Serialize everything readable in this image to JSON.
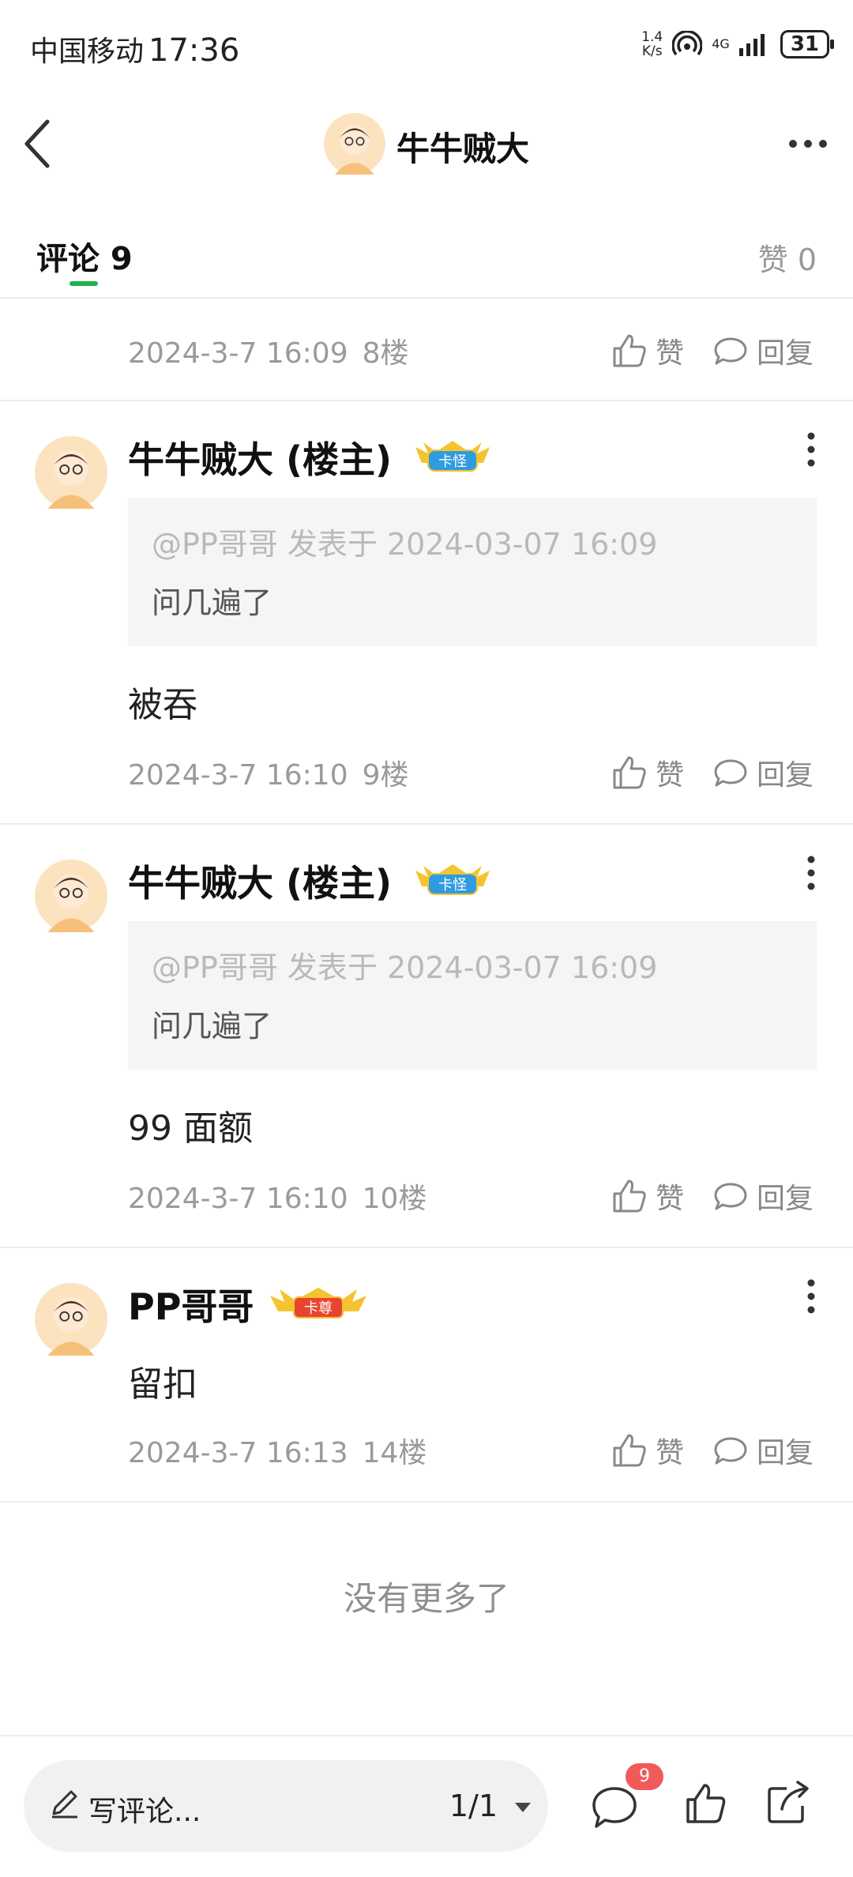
{
  "status_bar": {
    "carrier": "中国移动",
    "time": "17:36",
    "net_speed": "1.4",
    "net_speed_unit": "K/s",
    "network": "4G",
    "battery": "31"
  },
  "header": {
    "title": "牛牛贼大"
  },
  "tabs": {
    "comments_label": "评论 9",
    "likes_label": "赞 0"
  },
  "actions": {
    "like": "赞",
    "reply": "回复"
  },
  "comments": [
    {
      "time": "2024-3-7 16:09",
      "floor": "8楼"
    },
    {
      "author": "牛牛贼大 (楼主)",
      "badge": "卡怪",
      "quote_head": "@PP哥哥 发表于 2024-03-07 16:09",
      "quote_body": "问几遍了",
      "text": "被吞",
      "time": "2024-3-7 16:10",
      "floor": "9楼"
    },
    {
      "author": "牛牛贼大 (楼主)",
      "badge": "卡怪",
      "quote_head": "@PP哥哥 发表于 2024-03-07 16:09",
      "quote_body": "问几遍了",
      "text": "99 面额",
      "time": "2024-3-7 16:10",
      "floor": "10楼"
    },
    {
      "author": "PP哥哥",
      "badge": "卡尊",
      "text": "留扣",
      "time": "2024-3-7 16:13",
      "floor": "14楼"
    }
  ],
  "no_more": "没有更多了",
  "bottom_bar": {
    "write_placeholder": "写评论...",
    "page": "1/1",
    "comment_count": "9"
  },
  "colors": {
    "accent_green": "#22b14c",
    "badge_red": "#f15a5a"
  }
}
